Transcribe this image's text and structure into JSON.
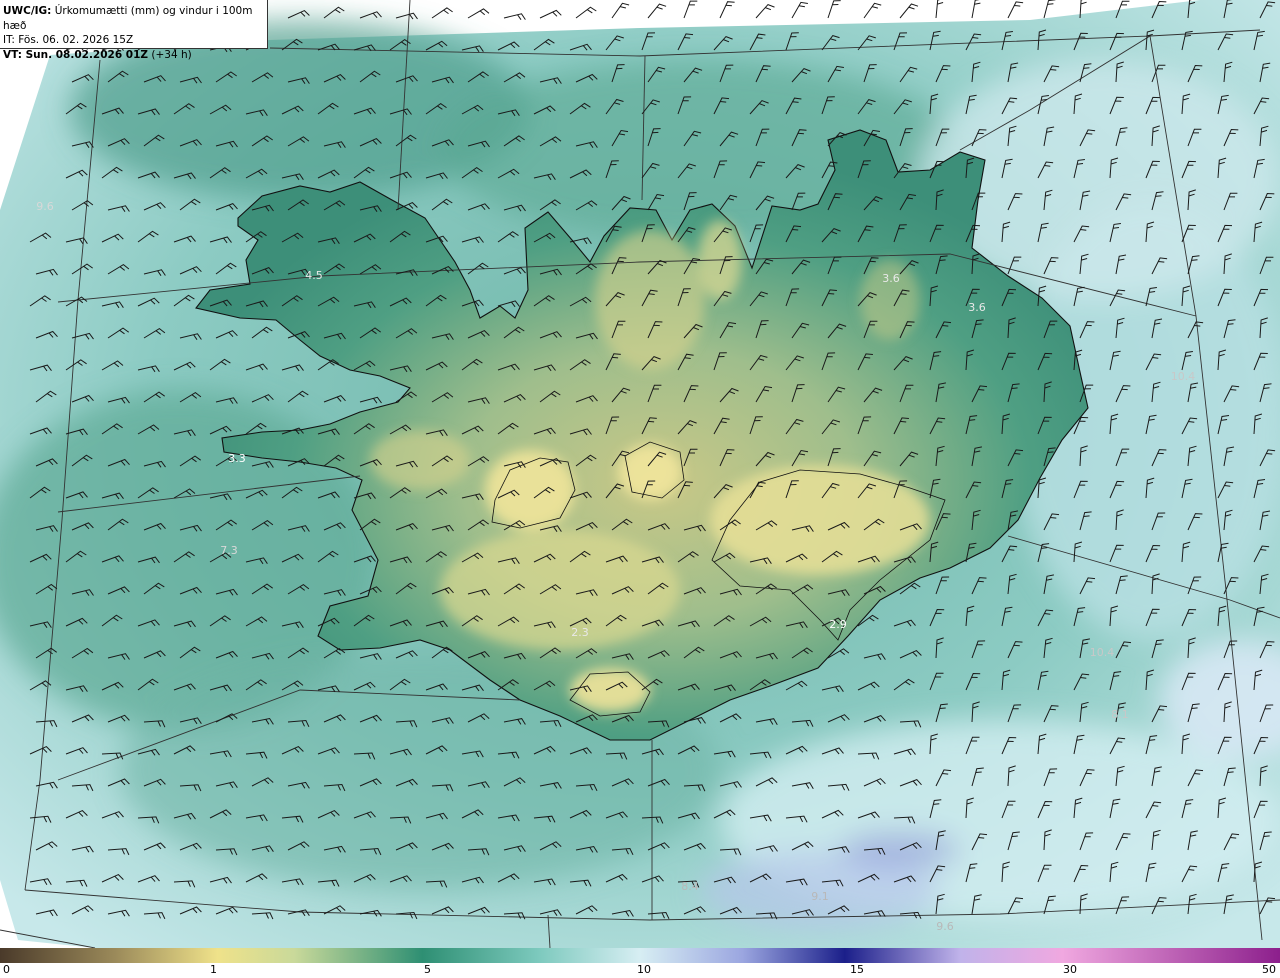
{
  "header": {
    "model_label": "UWC/IG:",
    "title": "Úrkomumætti (mm) og vindur i 100m hæð",
    "issue_time": "IT: Fös. 06. 02. 2026 15Z",
    "valid_prefix": "VT: Sun. 08.02.2026 01Z",
    "valid_offset": "(+34 h)"
  },
  "colorbar": {
    "ticks": [
      "0",
      "1",
      "5",
      "10",
      "15",
      "30",
      "50"
    ],
    "colors": [
      "#4a3a2a",
      "#b7a56c",
      "#efe28a",
      "#c9d99a",
      "#2e8f73",
      "#9fd9d4",
      "#d7eef3",
      "#6f74c8",
      "#1b1f8a",
      "#b9a6e0",
      "#f0a8e0",
      "#8c1f8c"
    ]
  },
  "map_labels": [
    {
      "text": "9.6",
      "color": "#d8d8d8"
    },
    {
      "text": "4.5",
      "color": "#e8e8e8"
    },
    {
      "text": "3.3",
      "color": "#ffffff"
    },
    {
      "text": "7.3",
      "color": "#d8d8d8"
    },
    {
      "text": "3.6",
      "color": "#e8e8e8"
    },
    {
      "text": "3.6",
      "color": "#e8e8e8"
    },
    {
      "text": "10.4",
      "color": "#c8c8c8"
    },
    {
      "text": "2.3",
      "color": "#e8e8e8"
    },
    {
      "text": "2.9",
      "color": "#ffffff"
    },
    {
      "text": "10.4",
      "color": "#c8c8c8"
    },
    {
      "text": "8.1",
      "color": "#c8c8c8"
    },
    {
      "text": "9.6",
      "color": "#b8b8b8"
    },
    {
      "text": "9.1",
      "color": "#b8b8b8"
    },
    {
      "text": "8.4",
      "color": "#b8b8b8"
    }
  ]
}
